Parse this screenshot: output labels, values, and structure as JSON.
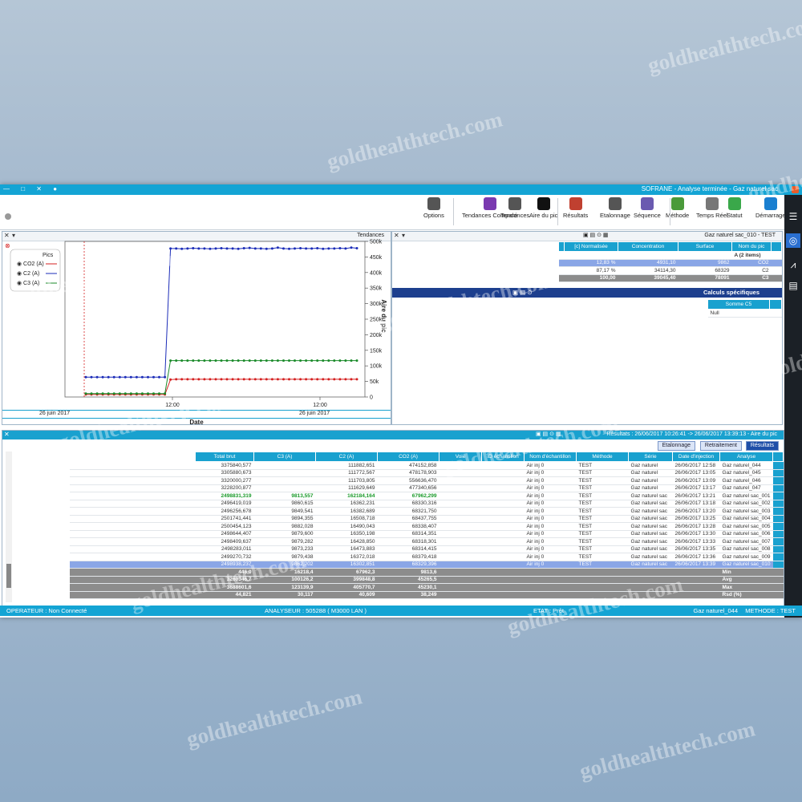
{
  "watermark": "goldhealthtech.com",
  "window": {
    "title": "SOFRANE - Analyse terminée - Gaz naturel sac",
    "controls": "— □ ✕ ●"
  },
  "toolbar": {
    "items": [
      {
        "label": "Démarrage",
        "icon": "play-icon",
        "color": "#1a7fd0"
      },
      {
        "label": "Statut",
        "icon": "status-icon",
        "color": "#3aa84a"
      },
      {
        "label": "Temps Réel",
        "icon": "clock-icon",
        "color": "#777777"
      },
      {
        "label": "Méthode",
        "icon": "method-icon",
        "color": "#4a9a3a"
      },
      {
        "label": "Séquence",
        "icon": "sequence-icon",
        "color": "#6a5ab0"
      },
      {
        "label": "Etalonnage",
        "icon": "gear-icon",
        "color": "#555555"
      },
      {
        "label": "Résultats",
        "icon": "clipboard-icon",
        "color": "#c04030"
      },
      {
        "label": "Aire du pic",
        "icon": "peak-icon",
        "color": "#111111"
      },
      {
        "label": "Tendances",
        "icon": "trend-icon",
        "color": "#555555"
      },
      {
        "label": "Tendances Comparé",
        "icon": "compare-icon",
        "color": "#7a3ab0"
      },
      {
        "label": "Options",
        "icon": "cogs-icon",
        "color": "#555555"
      }
    ]
  },
  "trend_panel": {
    "title": "Tendances",
    "legend_title": "Pics",
    "xlabel": "Date",
    "ylabel": "Aire du pic",
    "x_ticks": [
      "12:00",
      "12:00"
    ],
    "date_labels": [
      "26 juin 2017",
      "26 juin 2017"
    ]
  },
  "chart_data": {
    "type": "line",
    "title": "Tendances",
    "xlabel": "Date",
    "ylabel": "Aire du pic",
    "ylim": [
      0,
      500000
    ],
    "y_ticks": [
      "0",
      "50k",
      "100k",
      "150k",
      "200k",
      "250k",
      "300k",
      "350k",
      "400k",
      "450k",
      "500k"
    ],
    "x_ticks": [
      "12:00",
      "12:00"
    ],
    "grid": false,
    "legend_position": "top-right",
    "series": [
      {
        "name": "CO2 (A)",
        "color": "#d42020",
        "values": [
          8000,
          8000,
          8000,
          8000,
          8000,
          8000,
          8000,
          8000,
          8000,
          8000,
          8000,
          8000,
          8000,
          8000,
          8000,
          56000,
          57000,
          57000,
          57000,
          57000,
          57000,
          57000,
          57000,
          57000,
          57000,
          57000,
          57000,
          57000,
          57000,
          57000,
          57000,
          57000,
          57000,
          57000,
          57000,
          57000,
          57000,
          57000,
          57000,
          57000,
          57000,
          57000,
          57000,
          57000,
          57000,
          57000,
          57000,
          57000,
          57000
        ]
      },
      {
        "name": "C2 (A)",
        "color": "#1b2cb8",
        "values": [
          64000,
          64000,
          64000,
          64000,
          64000,
          64000,
          64000,
          64000,
          64000,
          64000,
          64000,
          64000,
          64000,
          64000,
          64000,
          477000,
          477000,
          476000,
          477000,
          478000,
          477000,
          477000,
          476000,
          477000,
          478000,
          477000,
          477000,
          476000,
          478000,
          479000,
          477000,
          477000,
          476000,
          477000,
          480000,
          477000,
          476000,
          477000,
          478000,
          477000,
          477000,
          478000,
          476000,
          477000,
          477000,
          478000,
          477000,
          480000,
          478000
        ]
      },
      {
        "name": "C3 (A)",
        "color": "#1a8a2a",
        "values": [
          11000,
          11000,
          11000,
          11000,
          11000,
          11000,
          11000,
          11000,
          11000,
          11000,
          11000,
          11000,
          11000,
          11000,
          11000,
          117000,
          117000,
          117000,
          117000,
          117000,
          117000,
          117000,
          117000,
          117000,
          117000,
          117000,
          117000,
          117000,
          117000,
          117000,
          117000,
          117000,
          117000,
          117000,
          117000,
          117000,
          117000,
          117000,
          117000,
          117000,
          117000,
          117000,
          117000,
          117000,
          117000,
          117000,
          117000,
          117000,
          117000
        ]
      }
    ]
  },
  "method_panel": {
    "header": "Gaz naturel sac_010 - TEST",
    "columns": [
      "Nom du pic",
      "Surface",
      "Concentration",
      "[c] Normalisée"
    ],
    "group_label": "A (2 items)",
    "rows": [
      {
        "name": "CO2",
        "surface": "9862",
        "conc": "4931,10",
        "norm": "12,83 %"
      },
      {
        "name": "C2",
        "surface": "68329",
        "conc": "34114,30",
        "norm": "87,17 %"
      },
      {
        "name": "C3",
        "surface": "78091",
        "conc": "39045,40",
        "norm": "100,00"
      }
    ],
    "calc_title": "Calculs spécifiques",
    "calc_columns": [
      "Somme C5"
    ],
    "calc_values": [
      "Null"
    ]
  },
  "results": {
    "title": "Résultats : 26/06/2017 10:26:41 -> 26/06/2017 13:39:13 - Aire du pic",
    "tabs": [
      "Résultats",
      "Retraitement",
      "Etalonnage"
    ],
    "columns": [
      "Analyse",
      "Date d'injection",
      "Série",
      "Méthode",
      "Nom d'échantillon",
      "ID échantillon",
      "Voie",
      "CO2 (A)",
      "C2 (A)",
      "C3 (A)",
      "Total brut"
    ],
    "rows": [
      [
        "Gaz naturel_044",
        "26/06/2017 12:58",
        "Gaz naturel",
        "TEST",
        "Air inj 0",
        "",
        "",
        "474152,858",
        "111882,651",
        "",
        "3375840,577"
      ],
      [
        "Gaz naturel_045",
        "26/06/2017 13:05",
        "Gaz naturel",
        "TEST",
        "Air inj 0",
        "",
        "",
        "478178,903",
        "111772,567",
        "",
        "3305880,673"
      ],
      [
        "Gaz naturel_046",
        "26/06/2017 13:09",
        "Gaz naturel",
        "TEST",
        "Air inj 0",
        "",
        "",
        "556636,470",
        "111703,805",
        "",
        "3320000,277"
      ],
      [
        "Gaz naturel_047",
        "26/06/2017 13:17",
        "Gaz naturel",
        "TEST",
        "Air inj 0",
        "",
        "",
        "477340,656",
        "111629,649",
        "",
        "3228200,877"
      ],
      [
        "Gaz naturel sac_001",
        "26/06/2017 13:21",
        "Gaz naturel sac",
        "TEST",
        "Air inj 0",
        "",
        "",
        "67962,299",
        "162184,164",
        "9813,557",
        "2498831,319"
      ],
      [
        "Gaz naturel sac_002",
        "26/06/2017 13:18",
        "Gaz naturel sac",
        "TEST",
        "Air inj 0",
        "",
        "",
        "68330,316",
        "16362,231",
        "9860,615",
        "2496419,019"
      ],
      [
        "Gaz naturel sac_003",
        "26/06/2017 13:20",
        "Gaz naturel sac",
        "TEST",
        "Air inj 0",
        "",
        "",
        "68321,750",
        "16382,689",
        "9849,541",
        "2496256,678"
      ],
      [
        "Gaz naturel sac_004",
        "26/06/2017 13:25",
        "Gaz naturel sac",
        "TEST",
        "Air inj 0",
        "",
        "",
        "68437,755",
        "16508,718",
        "9894,355",
        "2501741,441"
      ],
      [
        "Gaz naturel sac_005",
        "26/06/2017 13:28",
        "Gaz naturel sac",
        "TEST",
        "Air inj 0",
        "",
        "",
        "68338,407",
        "16490,043",
        "9882,028",
        "2500454,123"
      ],
      [
        "Gaz naturel sac_006",
        "26/06/2017 13:30",
        "Gaz naturel sac",
        "TEST",
        "Air inj 0",
        "",
        "",
        "68314,351",
        "16350,198",
        "9879,600",
        "2498644,407"
      ],
      [
        "Gaz naturel sac_007",
        "26/06/2017 13:33",
        "Gaz naturel sac",
        "TEST",
        "Air inj 0",
        "",
        "",
        "68318,301",
        "16428,850",
        "9879,282",
        "2498409,637"
      ],
      [
        "Gaz naturel sac_008",
        "26/06/2017 13:35",
        "Gaz naturel sac",
        "TEST",
        "Air inj 0",
        "",
        "",
        "68314,415",
        "16473,883",
        "9873,233",
        "2498283,011"
      ],
      [
        "Gaz naturel sac_009",
        "26/06/2017 13:36",
        "Gaz naturel sac",
        "TEST",
        "Air inj 0",
        "",
        "",
        "68379,418",
        "16372,018",
        "9879,438",
        "2499270,732"
      ],
      [
        "Gaz naturel sac_010",
        "26/06/2017 13:39",
        "Gaz naturel sac",
        "TEST",
        "Air inj 0",
        "",
        "",
        "68329,396",
        "16302,851",
        "9862,202",
        "2498938,237"
      ]
    ],
    "stats": [
      {
        "label": "Min",
        "values": [
          "9813,6",
          "67962,3",
          "16218,4",
          "446,0"
        ]
      },
      {
        "label": "Avg",
        "values": [
          "45265,5",
          "399848,8",
          "100126,2",
          "3260346,7"
        ]
      },
      {
        "label": "Max",
        "values": [
          "45230,1",
          "405770,7",
          "123139,9",
          "3688601,6"
        ]
      },
      {
        "label": "Rsd (%)",
        "values": [
          "38,249",
          "40,609",
          "30,117",
          "44,821"
        ]
      }
    ]
  },
  "statusbar": {
    "method": "METHODE : TEST",
    "analyse": "Gaz naturel_044",
    "etat": "ETAT : Prêt",
    "analyseur": "ANALYSEUR : 505288 ( M3000 LAN )",
    "operateur": "OPERATEUR : Non Connecté"
  }
}
